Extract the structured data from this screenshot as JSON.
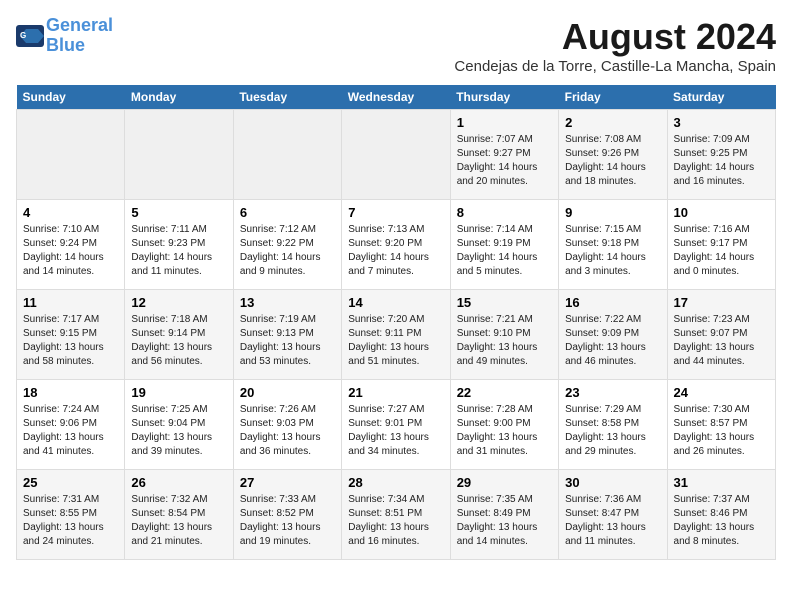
{
  "header": {
    "logo_line1": "General",
    "logo_line2": "Blue",
    "month_title": "August 2024",
    "location": "Cendejas de la Torre, Castille-La Mancha, Spain"
  },
  "days_of_week": [
    "Sunday",
    "Monday",
    "Tuesday",
    "Wednesday",
    "Thursday",
    "Friday",
    "Saturday"
  ],
  "weeks": [
    [
      {
        "day": "",
        "content": ""
      },
      {
        "day": "",
        "content": ""
      },
      {
        "day": "",
        "content": ""
      },
      {
        "day": "",
        "content": ""
      },
      {
        "day": "1",
        "content": "Sunrise: 7:07 AM\nSunset: 9:27 PM\nDaylight: 14 hours\nand 20 minutes."
      },
      {
        "day": "2",
        "content": "Sunrise: 7:08 AM\nSunset: 9:26 PM\nDaylight: 14 hours\nand 18 minutes."
      },
      {
        "day": "3",
        "content": "Sunrise: 7:09 AM\nSunset: 9:25 PM\nDaylight: 14 hours\nand 16 minutes."
      }
    ],
    [
      {
        "day": "4",
        "content": "Sunrise: 7:10 AM\nSunset: 9:24 PM\nDaylight: 14 hours\nand 14 minutes."
      },
      {
        "day": "5",
        "content": "Sunrise: 7:11 AM\nSunset: 9:23 PM\nDaylight: 14 hours\nand 11 minutes."
      },
      {
        "day": "6",
        "content": "Sunrise: 7:12 AM\nSunset: 9:22 PM\nDaylight: 14 hours\nand 9 minutes."
      },
      {
        "day": "7",
        "content": "Sunrise: 7:13 AM\nSunset: 9:20 PM\nDaylight: 14 hours\nand 7 minutes."
      },
      {
        "day": "8",
        "content": "Sunrise: 7:14 AM\nSunset: 9:19 PM\nDaylight: 14 hours\nand 5 minutes."
      },
      {
        "day": "9",
        "content": "Sunrise: 7:15 AM\nSunset: 9:18 PM\nDaylight: 14 hours\nand 3 minutes."
      },
      {
        "day": "10",
        "content": "Sunrise: 7:16 AM\nSunset: 9:17 PM\nDaylight: 14 hours\nand 0 minutes."
      }
    ],
    [
      {
        "day": "11",
        "content": "Sunrise: 7:17 AM\nSunset: 9:15 PM\nDaylight: 13 hours\nand 58 minutes."
      },
      {
        "day": "12",
        "content": "Sunrise: 7:18 AM\nSunset: 9:14 PM\nDaylight: 13 hours\nand 56 minutes."
      },
      {
        "day": "13",
        "content": "Sunrise: 7:19 AM\nSunset: 9:13 PM\nDaylight: 13 hours\nand 53 minutes."
      },
      {
        "day": "14",
        "content": "Sunrise: 7:20 AM\nSunset: 9:11 PM\nDaylight: 13 hours\nand 51 minutes."
      },
      {
        "day": "15",
        "content": "Sunrise: 7:21 AM\nSunset: 9:10 PM\nDaylight: 13 hours\nand 49 minutes."
      },
      {
        "day": "16",
        "content": "Sunrise: 7:22 AM\nSunset: 9:09 PM\nDaylight: 13 hours\nand 46 minutes."
      },
      {
        "day": "17",
        "content": "Sunrise: 7:23 AM\nSunset: 9:07 PM\nDaylight: 13 hours\nand 44 minutes."
      }
    ],
    [
      {
        "day": "18",
        "content": "Sunrise: 7:24 AM\nSunset: 9:06 PM\nDaylight: 13 hours\nand 41 minutes."
      },
      {
        "day": "19",
        "content": "Sunrise: 7:25 AM\nSunset: 9:04 PM\nDaylight: 13 hours\nand 39 minutes."
      },
      {
        "day": "20",
        "content": "Sunrise: 7:26 AM\nSunset: 9:03 PM\nDaylight: 13 hours\nand 36 minutes."
      },
      {
        "day": "21",
        "content": "Sunrise: 7:27 AM\nSunset: 9:01 PM\nDaylight: 13 hours\nand 34 minutes."
      },
      {
        "day": "22",
        "content": "Sunrise: 7:28 AM\nSunset: 9:00 PM\nDaylight: 13 hours\nand 31 minutes."
      },
      {
        "day": "23",
        "content": "Sunrise: 7:29 AM\nSunset: 8:58 PM\nDaylight: 13 hours\nand 29 minutes."
      },
      {
        "day": "24",
        "content": "Sunrise: 7:30 AM\nSunset: 8:57 PM\nDaylight: 13 hours\nand 26 minutes."
      }
    ],
    [
      {
        "day": "25",
        "content": "Sunrise: 7:31 AM\nSunset: 8:55 PM\nDaylight: 13 hours\nand 24 minutes."
      },
      {
        "day": "26",
        "content": "Sunrise: 7:32 AM\nSunset: 8:54 PM\nDaylight: 13 hours\nand 21 minutes."
      },
      {
        "day": "27",
        "content": "Sunrise: 7:33 AM\nSunset: 8:52 PM\nDaylight: 13 hours\nand 19 minutes."
      },
      {
        "day": "28",
        "content": "Sunrise: 7:34 AM\nSunset: 8:51 PM\nDaylight: 13 hours\nand 16 minutes."
      },
      {
        "day": "29",
        "content": "Sunrise: 7:35 AM\nSunset: 8:49 PM\nDaylight: 13 hours\nand 14 minutes."
      },
      {
        "day": "30",
        "content": "Sunrise: 7:36 AM\nSunset: 8:47 PM\nDaylight: 13 hours\nand 11 minutes."
      },
      {
        "day": "31",
        "content": "Sunrise: 7:37 AM\nSunset: 8:46 PM\nDaylight: 13 hours\nand 8 minutes."
      }
    ]
  ]
}
